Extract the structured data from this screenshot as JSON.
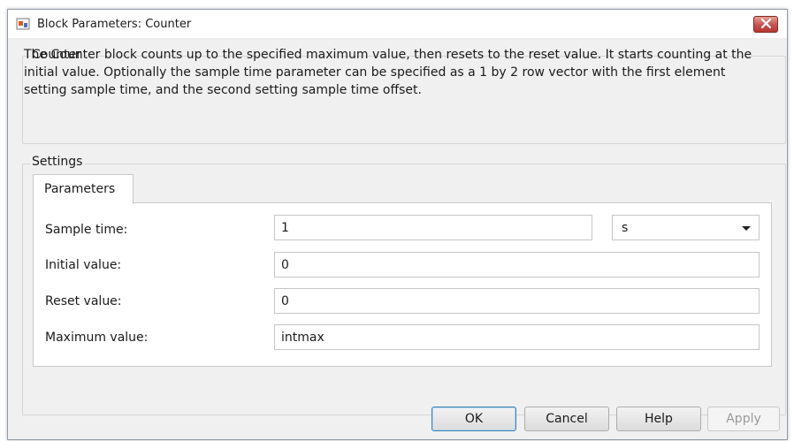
{
  "window": {
    "title": "Block Parameters: Counter"
  },
  "description_group": {
    "label": "Counter",
    "text": "The Counter block counts up to the specified maximum value, then resets to the reset value. It starts counting at the initial value. Optionally the sample time parameter can be specified as a 1 by 2 row vector with the first element setting sample time, and the second setting sample time offset."
  },
  "settings_group": {
    "label": "Settings",
    "tabs": [
      {
        "label": "Parameters"
      }
    ],
    "params": [
      {
        "label": "Sample time:",
        "value": "1"
      },
      {
        "label": "Initial value:",
        "value": "0"
      },
      {
        "label": "Reset value:",
        "value": "0"
      },
      {
        "label": "Maximum value:",
        "value": "intmax"
      }
    ],
    "sample_time_unit": {
      "selected": "s"
    }
  },
  "buttons": {
    "ok": "OK",
    "cancel": "Cancel",
    "help": "Help",
    "apply": "Apply"
  },
  "colors": {
    "close_button": "#c75050",
    "window_bg": "#f0f0f0",
    "default_button_border": "#3c7fb1"
  },
  "icons": {
    "app": "simulink-block-icon",
    "close": "close-icon",
    "dropdown": "chevron-down-icon"
  }
}
